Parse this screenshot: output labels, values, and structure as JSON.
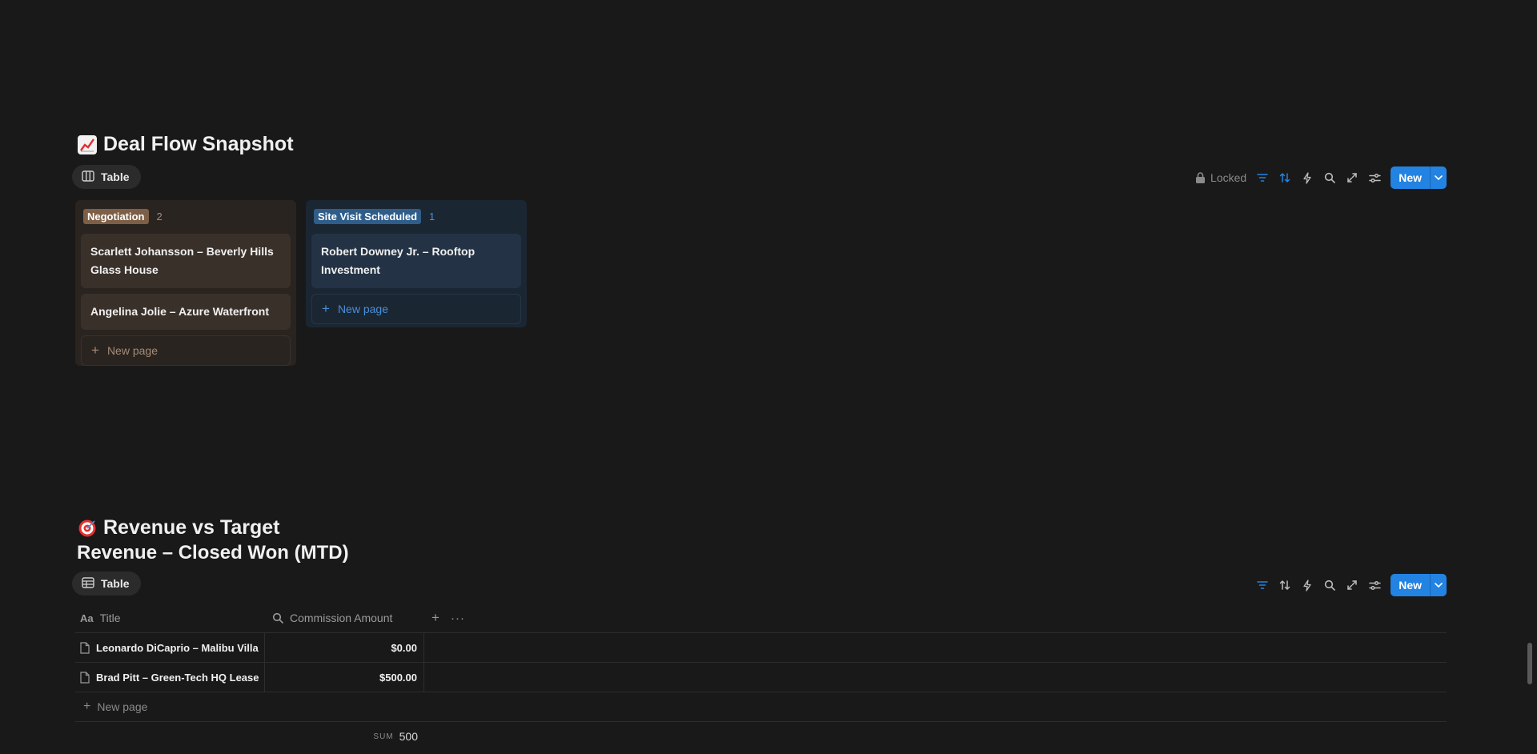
{
  "deal_flow": {
    "title": "Deal Flow Snapshot",
    "view_label": "Table",
    "toolbar": {
      "locked_label": "Locked",
      "new_label": "New"
    },
    "columns": [
      {
        "tag": "Negotiation",
        "count": "2",
        "cards": [
          {
            "title": "Scarlett Johansson – Beverly Hills Glass House"
          },
          {
            "title": "Angelina Jolie – Azure Waterfront"
          }
        ],
        "new_page_label": "New page"
      },
      {
        "tag": "Site Visit Scheduled",
        "count": "1",
        "cards": [
          {
            "title": "Robert Downey Jr. – Rooftop Investment"
          }
        ],
        "new_page_label": "New page"
      }
    ]
  },
  "revenue": {
    "title": "Revenue vs Target",
    "subtitle": "Revenue – Closed Won (MTD)",
    "view_label": "Table",
    "toolbar": {
      "new_label": "New"
    },
    "table": {
      "headers": {
        "title": "Title",
        "amount": "Commission Amount"
      },
      "rows": [
        {
          "title": "Leonardo DiCaprio – Malibu Villa",
          "amount": "$0.00"
        },
        {
          "title": "Brad Pitt – Green-Tech HQ Lease",
          "amount": "$500.00"
        }
      ],
      "new_page_label": "New page",
      "sum_label": "SUM",
      "sum_value": "500"
    }
  },
  "colors": {
    "background": "#191919",
    "accent": "#2383e2",
    "negotiation_tag": "#7d5f47",
    "site_visit_tag": "#2f5d8a"
  }
}
